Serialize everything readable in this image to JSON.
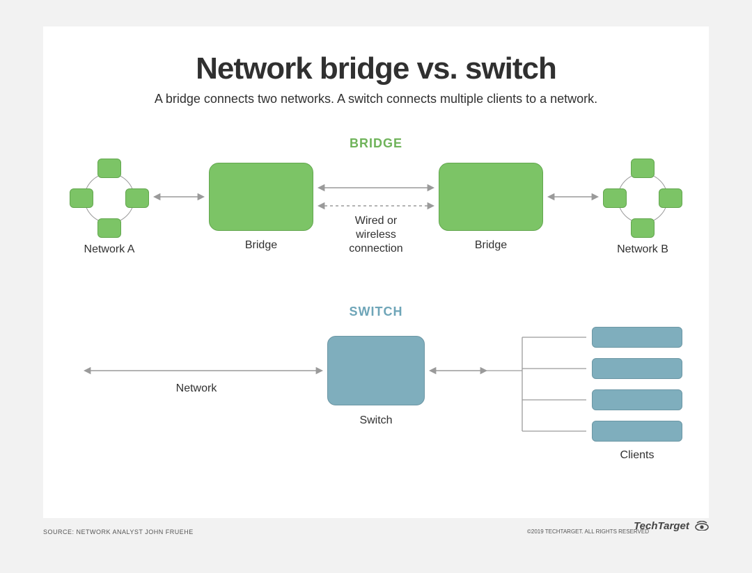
{
  "title": "Network bridge vs. switch",
  "subtitle": "A bridge connects two networks. A switch connects multiple clients to a network.",
  "bridge": {
    "heading": "BRIDGE",
    "networkA": "Network A",
    "networkB": "Network B",
    "bridgeLabel": "Bridge",
    "connection": "Wired or\nwireless\nconnection"
  },
  "switch": {
    "heading": "SWITCH",
    "networkLabel": "Network",
    "switchLabel": "Switch",
    "clientsLabel": "Clients",
    "clientCount": 4
  },
  "footer": {
    "source": "SOURCE: NETWORK ANALYST JOHN FRUEHE",
    "copyright": "©2019 TECHTARGET. ALL RIGHTS RESERVED",
    "brand": "TechTarget"
  },
  "colors": {
    "green": "#7cc466",
    "blue": "#7faebd",
    "arrow": "#9a9a9a"
  }
}
